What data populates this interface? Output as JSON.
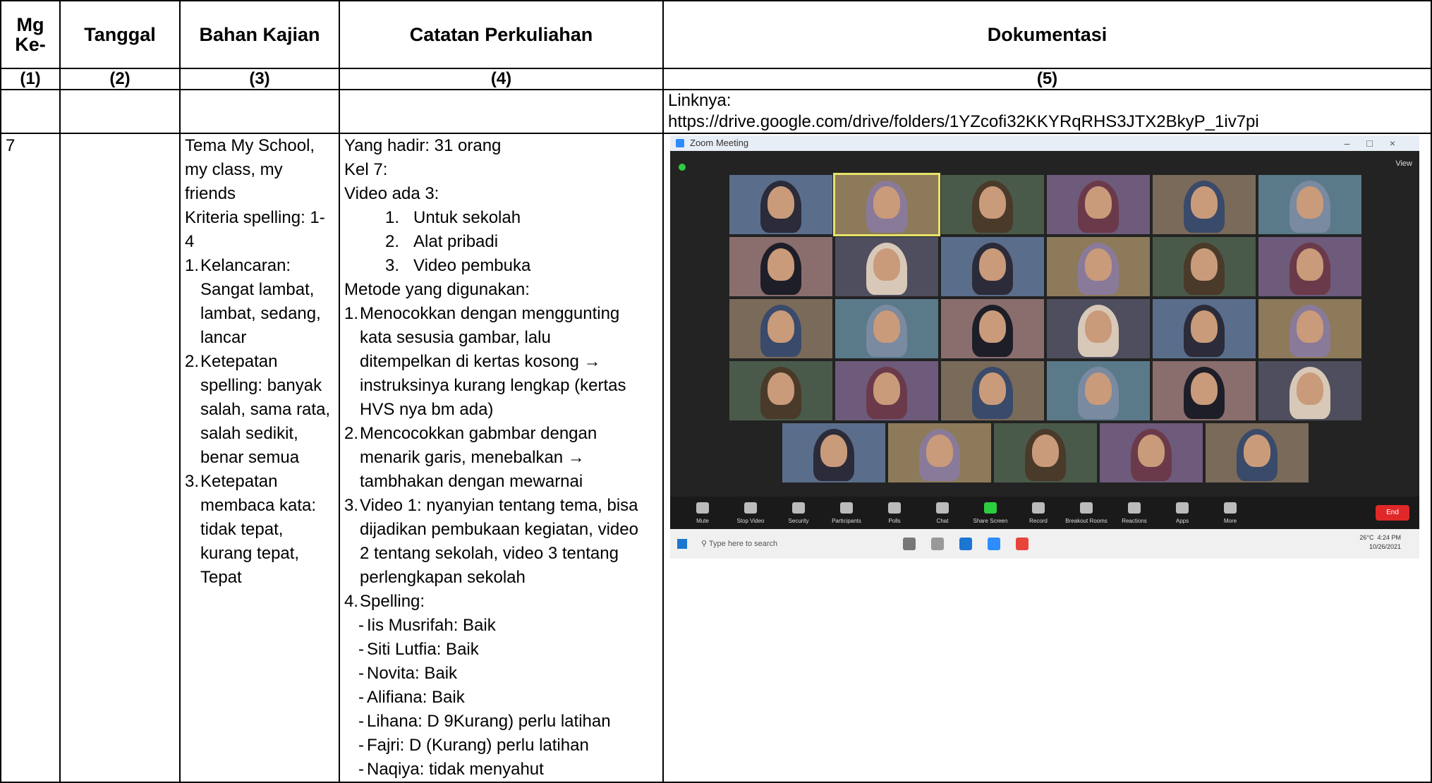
{
  "headers": {
    "mg": "Mg Ke-",
    "tanggal": "Tanggal",
    "bahan": "Bahan Kajian",
    "catatan": "Catatan Perkuliahan",
    "dokumentasi": "Dokumentasi"
  },
  "col_numbers": [
    "(1)",
    "(2)",
    "(3)",
    "(4)",
    "(5)"
  ],
  "link_row": {
    "label": "Linknya:",
    "url": "https://drive.google.com/drive/folders/1YZcofi32KKYRqRHS3JTX2BkyP_1iv7pi"
  },
  "week": "7",
  "bahan_kajian": {
    "intro": [
      "Tema My School,",
      "my class, my",
      "friends",
      "Kriteria spelling: 1-",
      "4"
    ],
    "items": [
      {
        "n": "1.",
        "lines": [
          "Kelancaran:",
          "Sangat lambat,",
          "lambat, sedang,",
          "lancar"
        ]
      },
      {
        "n": "2.",
        "lines": [
          "Ketepatan",
          "spelling: banyak",
          "salah, sama rata,",
          "salah sedikit,",
          "benar semua"
        ]
      },
      {
        "n": "3.",
        "lines": [
          "Ketepatan",
          "membaca kata:",
          "tidak tepat,",
          "kurang tepat,",
          "Tepat"
        ]
      }
    ]
  },
  "catatan": {
    "hadir": "Yang hadir: 31 orang",
    "kel": "Kel 7:",
    "video_title": "Video ada 3:",
    "videos": [
      {
        "n": "1.",
        "t": "Untuk sekolah"
      },
      {
        "n": "2.",
        "t": "Alat pribadi"
      },
      {
        "n": "3.",
        "t": "Video pembuka"
      }
    ],
    "metode_title": "Metode yang digunakan:",
    "metode": [
      {
        "n": "1.",
        "lines": [
          "Menocokkan dengan menggunting",
          "kata sesusia gambar, lalu",
          "ditempelkan di kertas kosong →",
          "instruksinya kurang lengkap (kertas",
          "HVS nya bm ada)"
        ]
      },
      {
        "n": "2.",
        "lines": [
          "Mencocokkan gabmbar dengan",
          "menarik garis, menebalkan →",
          "tambhakan dengan mewarnai"
        ]
      },
      {
        "n": "3.",
        "lines": [
          "Video 1: nyanyian tentang tema, bisa",
          "dijadikan pembukaan kegiatan, video",
          "2 tentang sekolah, video 3 tentang",
          "perlengkapan sekolah"
        ]
      },
      {
        "n": "4.",
        "lines": [
          "Spelling:"
        ]
      }
    ],
    "spelling": [
      "Iis Musrifah: Baik",
      "Siti Lutfia: Baik",
      "Novita: Baik",
      "Alifiana: Baik",
      "Lihana: D 9Kurang) perlu latihan",
      "Fajri: D (Kurang) perlu latihan",
      "Naqiya: tidak menyahut"
    ]
  },
  "zoom": {
    "title": "Zoom Meeting",
    "view": "View",
    "rows": [
      6,
      6,
      6,
      6,
      5
    ],
    "toolbar": [
      "Mute",
      "Stop Video",
      "Security",
      "Participants",
      "Polls",
      "Chat",
      "Share Screen",
      "Record",
      "Breakout Rooms",
      "Reactions",
      "Apps",
      "More"
    ],
    "end": "End",
    "search": "Type here to search",
    "temp": "26°C",
    "time": "4:24 PM",
    "date": "10/26/2021",
    "colors": {
      "tile": "#3a3a3a",
      "bg": "#232323",
      "active": "#e7e36a",
      "end": "#e02828"
    }
  }
}
